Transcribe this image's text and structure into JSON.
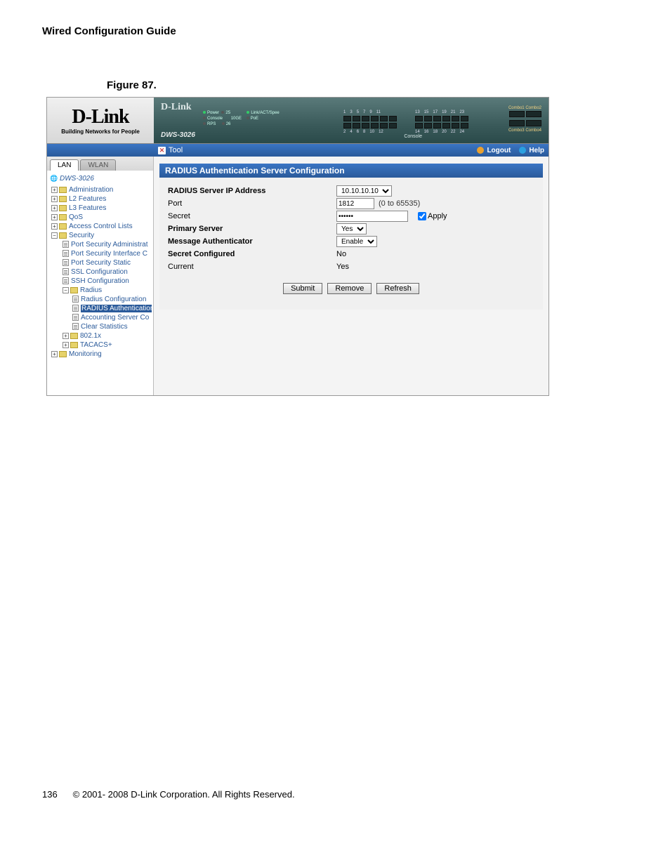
{
  "doc": {
    "guide_title": "Wired Configuration Guide",
    "figure_label": "Figure 87.",
    "page_number": "136",
    "copyright": "© 2001- 2008 D-Link Corporation. All Rights Reserved."
  },
  "logo": {
    "brand": "D-Link",
    "tagline": "Building Networks for People"
  },
  "device": {
    "brand_small": "D-Link",
    "model": "DWS-3026",
    "console_label": "Console",
    "leds": {
      "power": "Power",
      "console": "Console",
      "rps": "RPS",
      "tenge": "10GE",
      "linkact": "Link/ACT/Spee",
      "poe": "PoE",
      "p25": "25",
      "p26": "26"
    },
    "port_groups": [
      {
        "top": [
          "1",
          "3",
          "5",
          "7",
          "9",
          "11"
        ],
        "bottom": [
          "2",
          "4",
          "6",
          "8",
          "10",
          "12"
        ]
      },
      {
        "top": [
          "13",
          "15",
          "17",
          "19",
          "21",
          "23"
        ],
        "bottom": [
          "14",
          "16",
          "18",
          "20",
          "22",
          "24"
        ]
      }
    ],
    "combo": {
      "c1": "Combo1 Combo2",
      "c2": "Combo3 Combo4"
    }
  },
  "toolbar": {
    "tool": "Tool",
    "logout": "Logout",
    "help": "Help"
  },
  "tabs": {
    "lan": "LAN",
    "wlan": "WLAN"
  },
  "tree": {
    "root": "DWS-3026",
    "admin": "Administration",
    "l2": "L2 Features",
    "l3": "L3 Features",
    "qos": "QoS",
    "acl": "Access Control Lists",
    "security": "Security",
    "ps_admin": "Port Security Administrat",
    "ps_iface": "Port Security Interface C",
    "ps_static": "Port Security Static",
    "ssl": "SSL Configuration",
    "ssh": "SSH Configuration",
    "radius": "Radius",
    "radius_cfg": "Radius Configuration",
    "radius_auth": "RADIUS Authentication",
    "acct_srv": "Accounting Server Co",
    "clear_stats": "Clear Statistics",
    "dot1x": "802.1x",
    "tacacs": "TACACS+",
    "monitoring": "Monitoring"
  },
  "panel": {
    "title": "RADIUS Authentication Server Configuration",
    "labels": {
      "ip": "RADIUS Server IP Address",
      "port": "Port",
      "secret": "Secret",
      "primary": "Primary Server",
      "msgauth": "Message Authenticator",
      "secret_cfg": "Secret Configured",
      "current": "Current"
    },
    "values": {
      "ip": "10.10.10.10",
      "port": "1812",
      "port_hint": "(0 to 65535)",
      "secret": "******",
      "primary": "Yes",
      "msgauth": "Enable",
      "secret_cfg": "No",
      "current": "Yes"
    },
    "apply": "Apply",
    "buttons": {
      "submit": "Submit",
      "remove": "Remove",
      "refresh": "Refresh"
    }
  }
}
